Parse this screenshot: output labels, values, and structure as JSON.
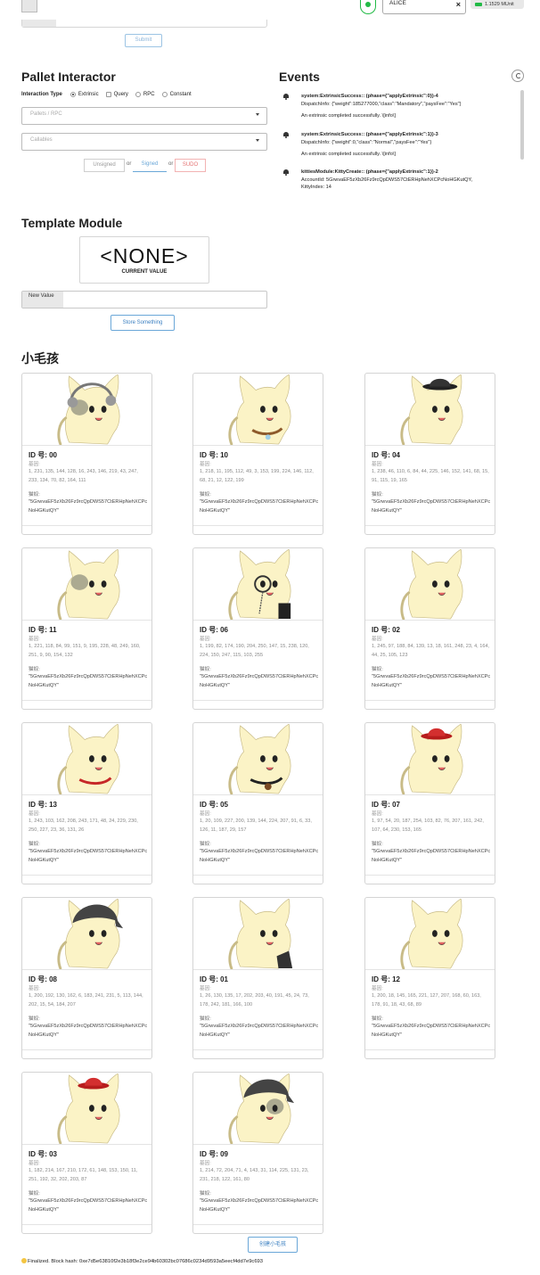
{
  "topbar": {
    "submit_label": "Submit",
    "account_name": "ALICE",
    "clear_icon": "×",
    "balance": "1.1529 MUnit"
  },
  "pallet_interactor": {
    "title": "Pallet Interactor",
    "interaction_type_label": "Interaction Type",
    "options": [
      "Extrinsic",
      "Query",
      "RPC",
      "Constant"
    ],
    "selected": "Extrinsic",
    "pallets_placeholder": "Pallets / RPC",
    "callables_placeholder": "Callables",
    "sign_buttons": {
      "unsigned": "Unsigned",
      "signed": "Signed",
      "sudo": "SUDO",
      "or": "or"
    }
  },
  "events": {
    "title": "Events",
    "items": [
      {
        "title": "system:ExtrinsicSuccess:: (phase={\"applyExtrinsic\":0})-4",
        "detail": "DispatchInfo: {\"weight\":185277000,\"class\":\"Mandatory\",\"paysFee\":\"Yes\"}",
        "desc": "An extrinsic completed successfully. \\[info\\]"
      },
      {
        "title": "system:ExtrinsicSuccess:: (phase={\"applyExtrinsic\":1})-3",
        "detail": "DispatchInfo: {\"weight\":0,\"class\":\"Normal\",\"paysFee\":\"Yes\"}",
        "desc": "An extrinsic completed successfully. \\[info\\]"
      },
      {
        "title": "kittiesModule:KittyCreate:: (phase={\"applyExtrinsic\":1})-2",
        "detail": "AccountId: 5GrwvaEF5zXb26Fz9rcQpDWS57CtERHpNehXCPcNoHGKutQY,",
        "desc": "KittyIndex: 14"
      }
    ]
  },
  "template_module": {
    "title": "Template Module",
    "current_value": "<NONE>",
    "current_value_caption": "CURRENT VALUE",
    "new_value_label": "New Value",
    "store_button": "Store Something"
  },
  "kitties": {
    "title": "小毛孩",
    "dna_label": "基因:",
    "owner_label": "猫奴:",
    "owner": "\"5GrwvaEF5zXb26Fz9rcQpDWS57CtERHpNehXCPcNoHGKutQY\"",
    "items": [
      {
        "id": "ID 号: 00",
        "dna": "1, 231, 135, 144, 128, 16, 243, 146, 219, 43, 247, 233, 134, 70, 82, 164, 111",
        "accessory": "headphones",
        "face": "mask",
        "collar": "none"
      },
      {
        "id": "ID 号: 10",
        "dna": "1, 218, 11, 195, 112, 49, 3, 153, 199, 224, 146, 112, 68, 21, 12, 122, 199",
        "accessory": "none",
        "face": "plain",
        "collar": "bell"
      },
      {
        "id": "ID 号: 04",
        "dna": "1, 238, 46, 110, 6, 84, 44, 225, 146, 152, 141, 68, 15, 91, 115, 19, 165",
        "accessory": "bowler-hat",
        "face": "plain",
        "collar": "none"
      },
      {
        "id": "ID 号: 11",
        "dna": "1, 221, 118, 84, 99, 151, 9, 195, 228, 48, 249, 160, 251, 9, 90, 154, 132",
        "accessory": "none",
        "face": "mask",
        "collar": "none"
      },
      {
        "id": "ID 号: 06",
        "dna": "1, 199, 82, 174, 190, 204, 250, 147, 15, 238, 120, 224, 150, 247, 115, 103, 255",
        "accessory": "monocle",
        "face": "plain",
        "collar": "none"
      },
      {
        "id": "ID 号: 02",
        "dna": "1, 245, 97, 188, 84, 139, 13, 18, 161, 248, 23, 4, 164, 44, 25, 105, 123",
        "accessory": "none",
        "face": "plain",
        "collar": "none"
      },
      {
        "id": "ID 号: 13",
        "dna": "1, 243, 103, 162, 208, 243, 171, 48, 24, 229, 230, 250, 227, 23, 36, 131, 26",
        "accessory": "none",
        "face": "plain",
        "collar": "red"
      },
      {
        "id": "ID 号: 05",
        "dna": "1, 20, 109, 227, 200, 139, 144, 224, 207, 91, 6, 33, 126, 11, 187, 29, 157",
        "accessory": "none",
        "face": "plain",
        "collar": "black"
      },
      {
        "id": "ID 号: 07",
        "dna": "1, 97, 54, 20, 187, 254, 103, 82, 76, 207, 161, 242, 107, 64, 230, 153, 165",
        "accessory": "red-hat",
        "face": "plain",
        "collar": "none"
      },
      {
        "id": "ID 号: 08",
        "dna": "1, 200, 192, 130, 162, 6, 183, 241, 231, 5, 113, 144, 202, 15, 54, 184, 207",
        "accessory": "bandana",
        "face": "plain",
        "collar": "none"
      },
      {
        "id": "ID 号: 01",
        "dna": "1, 26, 130, 135, 17, 202, 203, 40, 191, 45, 24, 73, 178, 242, 181, 166, 100",
        "accessory": "none",
        "face": "plain",
        "collar": "glove"
      },
      {
        "id": "ID 号: 12",
        "dna": "1, 200, 18, 145, 165, 221, 127, 207, 168, 60, 163, 178, 91, 18, 43, 68, 89",
        "accessory": "none",
        "face": "plain",
        "collar": "none"
      },
      {
        "id": "ID 号: 03",
        "dna": "1, 182, 214, 167, 210, 172, 61, 148, 153, 150, 11, 251, 192, 32, 202, 203, 87",
        "accessory": "red-hat",
        "face": "plain",
        "collar": "none"
      },
      {
        "id": "ID 号: 09",
        "dna": "1, 214, 72, 204, 71, 4, 143, 31, 114, 225, 131, 23, 231, 218, 122, 161, 80",
        "accessory": "bandana",
        "face": "monocle",
        "collar": "none"
      }
    ],
    "create_button": "创建小毛孩"
  },
  "status": {
    "icon": "smile-icon",
    "text": "Finalized. Block hash: 0xe7d5e63810f2e3b18f3e2ce94b60302bc07686c0234d9593a5eecf4dd7e9c693"
  },
  "colors": {
    "accent": "#3a7fc1",
    "success": "#21ba45",
    "sudo": "#e57373",
    "kitty_body": "#fbf3c6"
  }
}
